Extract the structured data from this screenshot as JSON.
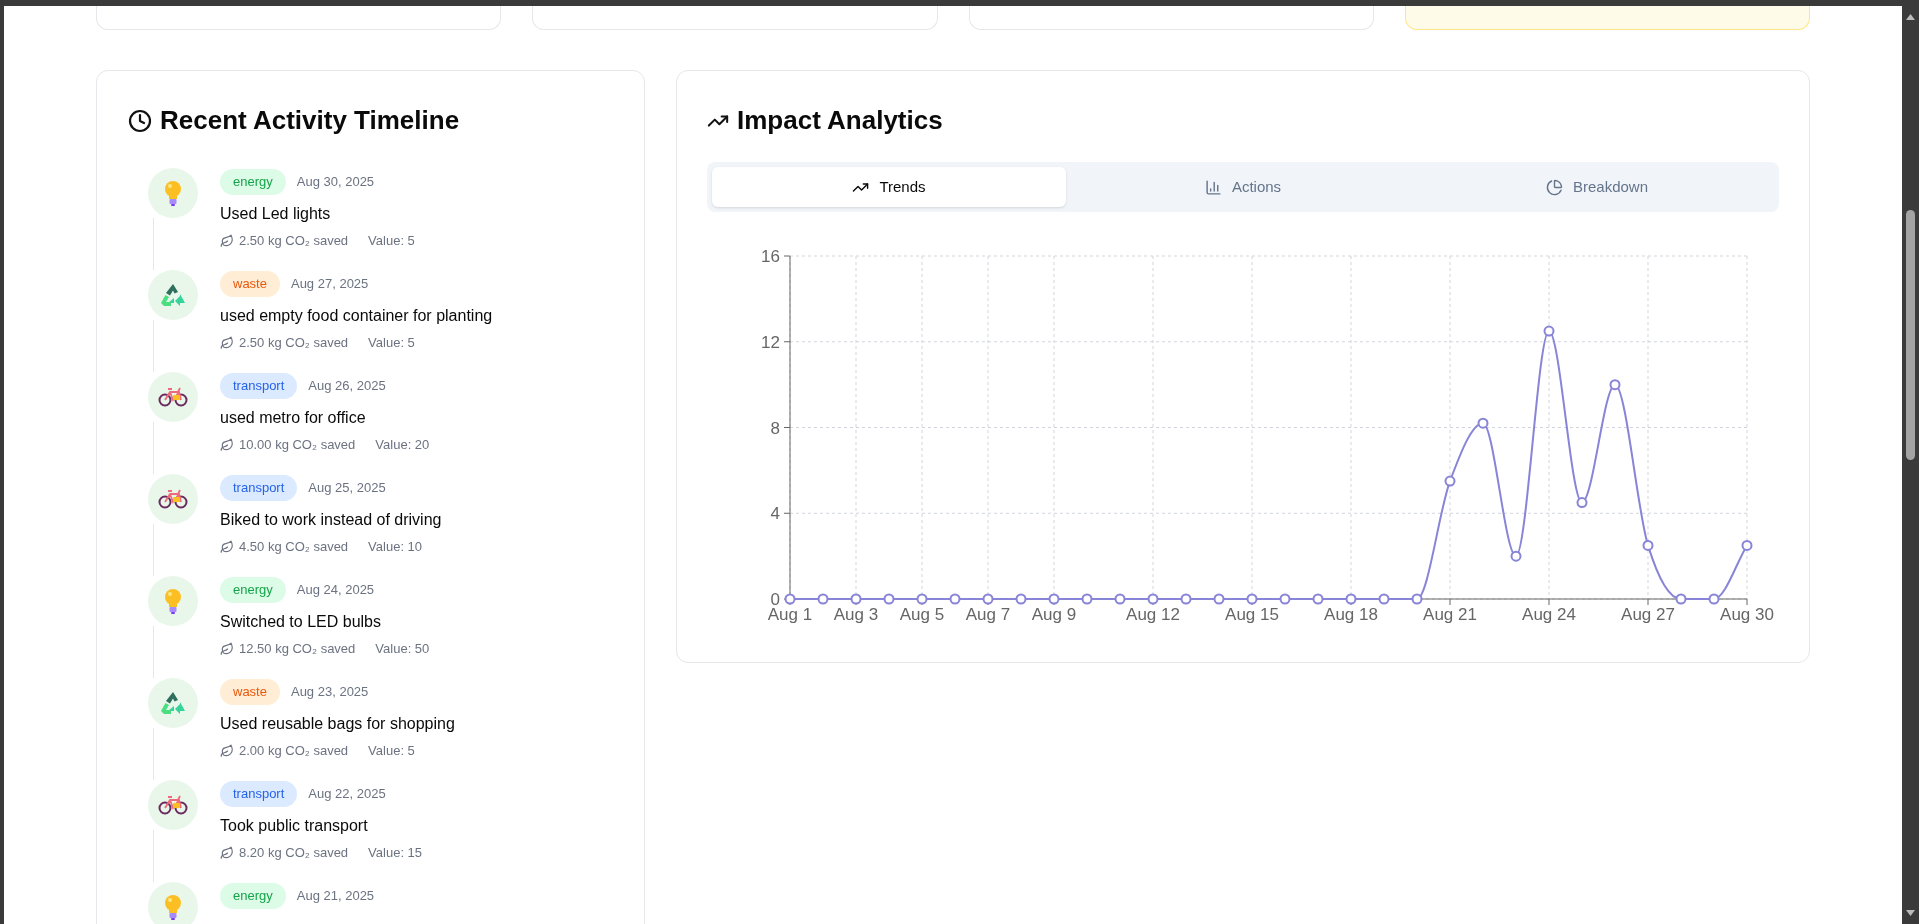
{
  "summary_cards": [
    {
      "highlighted": false
    },
    {
      "highlighted": false
    },
    {
      "highlighted": false
    },
    {
      "highlighted": true
    }
  ],
  "timeline": {
    "title": "Recent Activity Timeline",
    "items": [
      {
        "kind": "energy",
        "category": "energy",
        "date": "Aug 30, 2025",
        "title": "Used Led lights",
        "co2": "2.50 kg CO₂ saved",
        "value": "Value: 5"
      },
      {
        "kind": "waste",
        "category": "waste",
        "date": "Aug 27, 2025",
        "title": "used empty food container for planting",
        "co2": "2.50 kg CO₂ saved",
        "value": "Value: 5"
      },
      {
        "kind": "transport",
        "category": "transport",
        "date": "Aug 26, 2025",
        "title": "used metro for office",
        "co2": "10.00 kg CO₂ saved",
        "value": "Value: 20"
      },
      {
        "kind": "transport",
        "category": "transport",
        "date": "Aug 25, 2025",
        "title": "Biked to work instead of driving",
        "co2": "4.50 kg CO₂ saved",
        "value": "Value: 10"
      },
      {
        "kind": "energy",
        "category": "energy",
        "date": "Aug 24, 2025",
        "title": "Switched to LED bulbs",
        "co2": "12.50 kg CO₂ saved",
        "value": "Value: 50"
      },
      {
        "kind": "waste",
        "category": "waste",
        "date": "Aug 23, 2025",
        "title": "Used reusable bags for shopping",
        "co2": "2.00 kg CO₂ saved",
        "value": "Value: 5"
      },
      {
        "kind": "transport",
        "category": "transport",
        "date": "Aug 22, 2025",
        "title": "Took public transport",
        "co2": "8.20 kg CO₂ saved",
        "value": "Value: 15"
      },
      {
        "kind": "energy",
        "category": "energy",
        "date": "Aug 21, 2025"
      }
    ]
  },
  "analytics": {
    "title": "Impact Analytics",
    "tabs": [
      {
        "label": "Trends",
        "kind": "trends",
        "selected": true
      },
      {
        "label": "Actions",
        "kind": "actions",
        "selected": false
      },
      {
        "label": "Breakdown",
        "kind": "breakdown",
        "selected": false
      }
    ],
    "chart_data": {
      "type": "line",
      "grid": true,
      "categories": [
        "Aug 1",
        null,
        "Aug 3",
        null,
        "Aug 5",
        null,
        "Aug 7",
        null,
        "Aug 9",
        null,
        null,
        "Aug 12",
        null,
        null,
        "Aug 15",
        null,
        null,
        "Aug 18",
        null,
        null,
        "Aug 21",
        null,
        null,
        "Aug 24",
        null,
        null,
        "Aug 27",
        null,
        null,
        "Aug 30"
      ],
      "series": [
        {
          "color": "#8884d8",
          "marker": "circle",
          "values": [
            0,
            0,
            0,
            0,
            0,
            0,
            0,
            0,
            0,
            0,
            0,
            0,
            0,
            0,
            0,
            0,
            0,
            0,
            0,
            0,
            5.5,
            8.2,
            2,
            12.5,
            4.5,
            10,
            2.5,
            0,
            0,
            2.5
          ]
        }
      ],
      "ylim": [
        0,
        16
      ],
      "yticks": [
        0,
        4,
        8,
        12,
        16
      ]
    }
  }
}
